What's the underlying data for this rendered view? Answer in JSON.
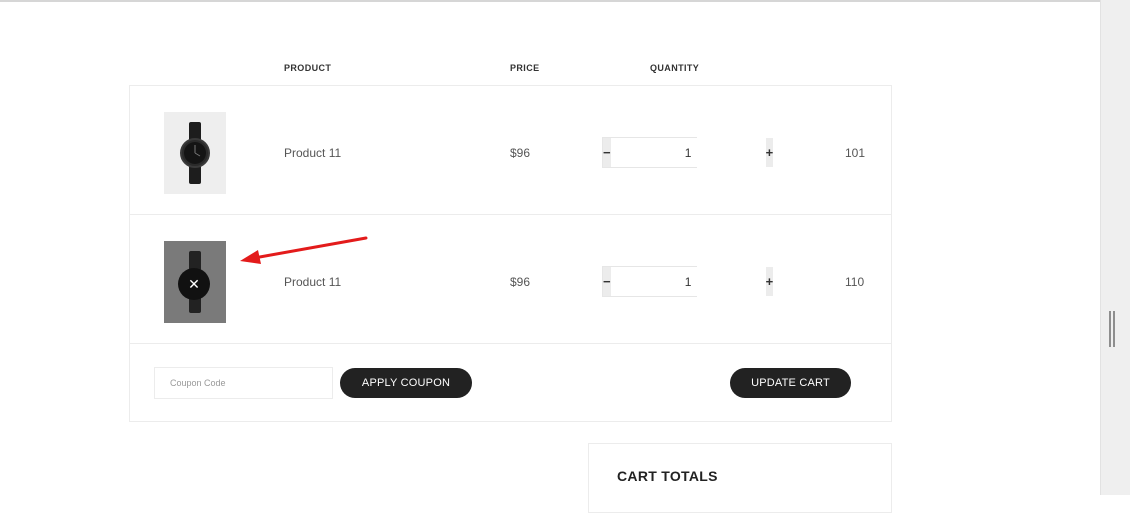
{
  "table": {
    "headers": {
      "product": "PRODUCT",
      "price": "PRICE",
      "quantity": "QUANTITY"
    },
    "rows": [
      {
        "name": "Product 11",
        "price": "$96",
        "quantity": "1",
        "subtotal": "101"
      },
      {
        "name": "Product 11",
        "price": "$96",
        "quantity": "1",
        "subtotal": "110"
      }
    ],
    "minus_glyph": "−",
    "plus_glyph": "+",
    "remove_glyph": "✕"
  },
  "actions": {
    "coupon_placeholder": "Coupon Code",
    "apply_coupon_label": "APPLY COUPON",
    "update_cart_label": "UPDATE CART"
  },
  "totals": {
    "title": "CART TOTALS"
  },
  "icons": {
    "product_image": "watch-icon",
    "remove": "close-icon",
    "annotation": "arrow-annotation"
  },
  "colors": {
    "button_bg": "#222222",
    "annotation_arrow": "#e31b1b",
    "hover_overlay": "#7a7a7a"
  }
}
